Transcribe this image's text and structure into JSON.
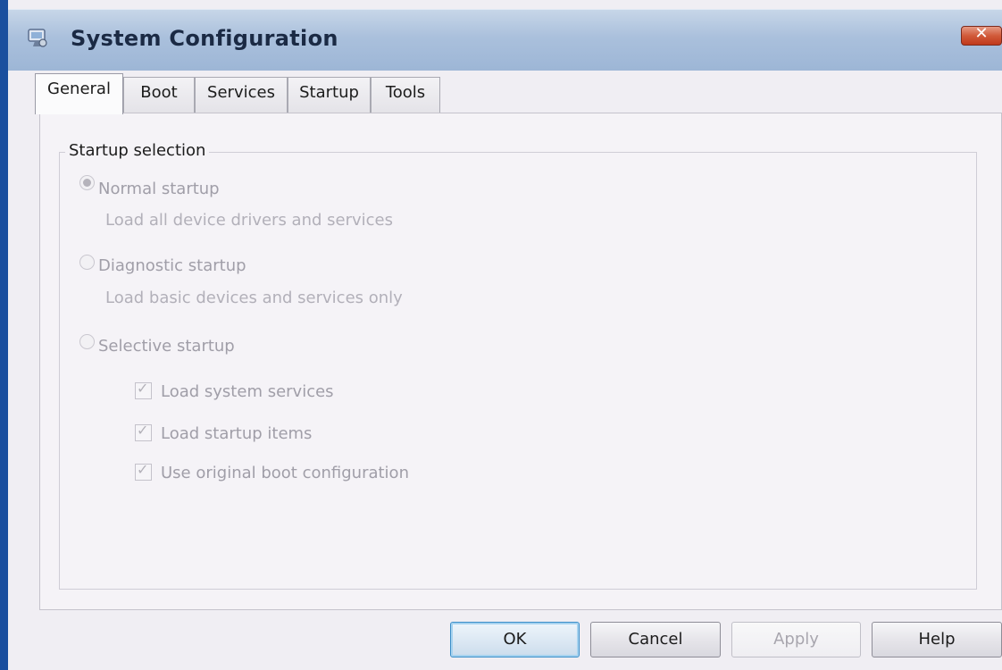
{
  "window": {
    "title": "System Configuration",
    "title_icon": "msconfig-icon",
    "close_glyph": "✕",
    "accent_color": "#1a4f9e"
  },
  "tabs": [
    {
      "label": "General",
      "active": true
    },
    {
      "label": "Boot",
      "active": false
    },
    {
      "label": "Services",
      "active": false
    },
    {
      "label": "Startup",
      "active": false
    },
    {
      "label": "Tools",
      "active": false
    }
  ],
  "startup_selection": {
    "group_title": "Startup selection",
    "options": [
      {
        "label": "Normal startup",
        "description": "Load all device drivers and services",
        "selected": true,
        "enabled": false
      },
      {
        "label": "Diagnostic startup",
        "description": "Load basic devices and services only",
        "selected": false,
        "enabled": false
      },
      {
        "label": "Selective startup",
        "description": "",
        "selected": false,
        "enabled": false
      }
    ],
    "checkboxes": [
      {
        "label": "Load system services",
        "checked": true,
        "enabled": false
      },
      {
        "label": "Load startup items",
        "checked": true,
        "enabled": false
      },
      {
        "label": "Use original boot configuration",
        "checked": true,
        "enabled": false
      }
    ]
  },
  "buttons": {
    "ok": "OK",
    "cancel": "Cancel",
    "apply": "Apply",
    "help": "Help"
  },
  "check_glyph": "✓"
}
